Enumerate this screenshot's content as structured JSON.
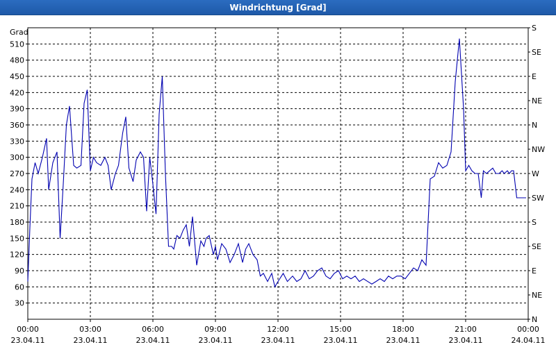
{
  "window": {
    "title": "Windrichtung [Grad]"
  },
  "chart_data": {
    "type": "line",
    "title": "Windrichtung [Grad]",
    "ylabel": "Grad",
    "xlabel": "",
    "ylim": [
      0,
      540
    ],
    "grid": true,
    "yticks": [
      30,
      60,
      90,
      120,
      150,
      180,
      210,
      240,
      270,
      300,
      330,
      360,
      390,
      420,
      450,
      480,
      510
    ],
    "yticks_right": [
      {
        "value": 0,
        "label": "N"
      },
      {
        "value": 45,
        "label": "NE"
      },
      {
        "value": 90,
        "label": "E"
      },
      {
        "value": 135,
        "label": "SE"
      },
      {
        "value": 180,
        "label": "S"
      },
      {
        "value": 225,
        "label": "SW"
      },
      {
        "value": 270,
        "label": "W"
      },
      {
        "value": 315,
        "label": "NW"
      },
      {
        "value": 360,
        "label": "N"
      },
      {
        "value": 405,
        "label": "NE"
      },
      {
        "value": 450,
        "label": "E"
      },
      {
        "value": 495,
        "label": "SE"
      },
      {
        "value": 540,
        "label": "S"
      }
    ],
    "x_range_hours": [
      0,
      24
    ],
    "xticks": [
      {
        "hour": 0,
        "time": "00:00",
        "date": "23.04.11"
      },
      {
        "hour": 3,
        "time": "03:00",
        "date": "23.04.11"
      },
      {
        "hour": 6,
        "time": "06:00",
        "date": "23.04.11"
      },
      {
        "hour": 9,
        "time": "09:00",
        "date": "23.04.11"
      },
      {
        "hour": 12,
        "time": "12:00",
        "date": "23.04.11"
      },
      {
        "hour": 15,
        "time": "15:00",
        "date": "23.04.11"
      },
      {
        "hour": 18,
        "time": "18:00",
        "date": "23.04.11"
      },
      {
        "hour": 21,
        "time": "21:00",
        "date": "23.04.11"
      },
      {
        "hour": 24,
        "time": "00:00",
        "date": "24.04.11"
      }
    ],
    "series": [
      {
        "color": "#0000b0",
        "x": [
          0.0,
          0.1,
          0.2,
          0.35,
          0.5,
          0.7,
          0.9,
          1.0,
          1.2,
          1.4,
          1.55,
          1.7,
          1.85,
          2.0,
          2.2,
          2.35,
          2.55,
          2.7,
          2.85,
          3.0,
          3.15,
          3.3,
          3.5,
          3.7,
          3.85,
          4.0,
          4.2,
          4.35,
          4.55,
          4.7,
          4.85,
          5.05,
          5.2,
          5.4,
          5.55,
          5.7,
          5.85,
          6.0,
          6.15,
          6.3,
          6.45,
          6.6,
          6.75,
          6.9,
          7.0,
          7.15,
          7.3,
          7.45,
          7.6,
          7.75,
          7.9,
          8.1,
          8.3,
          8.45,
          8.55,
          8.7,
          8.9,
          9.0,
          9.1,
          9.3,
          9.5,
          9.7,
          9.9,
          10.1,
          10.3,
          10.45,
          10.6,
          10.8,
          11.0,
          11.15,
          11.3,
          11.5,
          11.7,
          11.85,
          12.0,
          12.25,
          12.45,
          12.7,
          12.9,
          13.1,
          13.3,
          13.5,
          13.7,
          13.9,
          14.1,
          14.3,
          14.5,
          14.7,
          14.9,
          15.1,
          15.3,
          15.5,
          15.7,
          15.9,
          16.1,
          16.3,
          16.5,
          16.7,
          16.9,
          17.1,
          17.3,
          17.5,
          17.7,
          17.9,
          18.1,
          18.3,
          18.5,
          18.7,
          18.9,
          19.1,
          19.3,
          19.5,
          19.7,
          19.9,
          20.1,
          20.3,
          20.5,
          20.7,
          20.9,
          21.0,
          21.15,
          21.3,
          21.45,
          21.6,
          21.75,
          21.85,
          22.0,
          22.15,
          22.3,
          22.45,
          22.6,
          22.75,
          22.85,
          23.0,
          23.1,
          23.2,
          23.3,
          23.45,
          23.6,
          23.75,
          23.9
        ],
        "y": [
          70,
          170,
          260,
          290,
          270,
          300,
          335,
          240,
          290,
          310,
          150,
          250,
          360,
          395,
          285,
          280,
          285,
          400,
          425,
          275,
          300,
          290,
          285,
          300,
          285,
          240,
          270,
          285,
          345,
          375,
          280,
          255,
          295,
          310,
          300,
          200,
          300,
          250,
          195,
          380,
          450,
          270,
          135,
          135,
          130,
          155,
          150,
          165,
          175,
          135,
          190,
          100,
          145,
          135,
          150,
          155,
          120,
          135,
          110,
          140,
          130,
          105,
          120,
          140,
          105,
          130,
          140,
          120,
          110,
          80,
          85,
          70,
          85,
          60,
          70,
          85,
          70,
          80,
          70,
          75,
          90,
          75,
          80,
          90,
          95,
          80,
          75,
          85,
          90,
          75,
          80,
          75,
          80,
          70,
          75,
          70,
          65,
          70,
          75,
          70,
          80,
          75,
          80,
          80,
          75,
          85,
          95,
          90,
          110,
          100,
          260,
          265,
          290,
          280,
          285,
          310,
          440,
          520,
          390,
          275,
          285,
          275,
          270,
          270,
          225,
          275,
          270,
          275,
          280,
          270,
          270,
          275,
          270,
          275,
          270,
          275,
          275,
          225,
          225,
          225,
          225
        ]
      }
    ]
  }
}
